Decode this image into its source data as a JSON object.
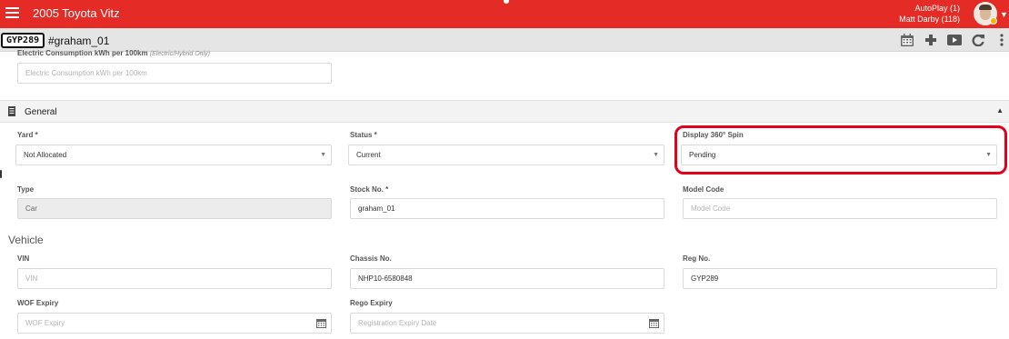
{
  "header": {
    "title": "2005 Toyota Vitz",
    "autoplay": "AutoPlay (1)",
    "user": "Matt Darby (118)"
  },
  "subheader": {
    "plate": "GYP289",
    "stock_id": "#graham_01"
  },
  "electric": {
    "label": "Electric Consumption kWh per 100km",
    "hint": "(Electric/Hybrid Only)",
    "placeholder": "Electric Consumption kWh per 100km"
  },
  "section": {
    "title": "General"
  },
  "fields": {
    "yard": {
      "label": "Yard *",
      "value": "Not Allocated"
    },
    "status": {
      "label": "Status *",
      "value": "Current"
    },
    "spin": {
      "label": "Display 360° Spin",
      "value": "Pending"
    },
    "type": {
      "label": "Type",
      "value": "Car"
    },
    "stock_no": {
      "label": "Stock No. *",
      "value": "graham_01"
    },
    "model_code": {
      "label": "Model Code",
      "placeholder": "Model Code"
    }
  },
  "vehicle": {
    "heading": "Vehicle",
    "vin": {
      "label": "VIN",
      "placeholder": "VIN"
    },
    "chassis": {
      "label": "Chassis No.",
      "value": "NHP10-6580848"
    },
    "reg": {
      "label": "Reg No.",
      "value": "GYP289"
    },
    "wof": {
      "label": "WOF Expiry",
      "placeholder": "WOF Expiry"
    },
    "rego": {
      "label": "Rego Expiry",
      "placeholder": "Registration Expiry Date"
    }
  },
  "icons": {
    "menu": "hamburger-icon",
    "calendar": "calendar-icon",
    "add": "plus-icon",
    "play": "play-icon",
    "refresh": "refresh-icon",
    "more": "more-vertical-icon",
    "section": "document-icon"
  },
  "colors": {
    "brand": "#e52b26",
    "highlight": "#e3001b"
  }
}
